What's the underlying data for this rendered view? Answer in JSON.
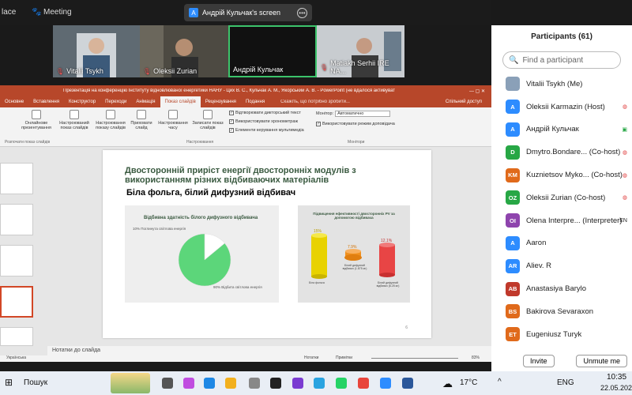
{
  "topbar": {
    "left_label": "lace",
    "meeting_label": "Meeting",
    "screen_badge": "Андрій Кульчак's screen",
    "badge_letter": "A"
  },
  "video_tiles": [
    {
      "name": "Vitalii Tsykh"
    },
    {
      "name": "Oleksii Zurian"
    },
    {
      "name": "Андрій Кульчак"
    },
    {
      "name": "Matiakh Serhii IRE NA..."
    }
  ],
  "ppt": {
    "title": "Презентація на конференцію Інституту відновлюваної енергетики НАНУ - Цих В. С., Кульчак А. М., Якорський А. В. - PowerPoint (не вдалося активувати п...",
    "tabs": [
      "Основне",
      "Вставлення",
      "Конструктор",
      "Переходи",
      "Анімація",
      "Показ слайдів",
      "Рецензування",
      "Подання"
    ],
    "active_tab": "Показ слайдів",
    "search": "Скажіть, що потрібно зробити...",
    "share": "Спільний доступ",
    "ribbon": {
      "b1": "Онлайнове презентування",
      "b2": "Настроюваний показ слайдів",
      "b3": "Настроювання показу слайдів",
      "b4": "Приховати слайд",
      "b5": "Настроювання часу",
      "b6": "Записати показ слайдів",
      "c1": "Відтворювати дикторський текст",
      "c2": "Використовувати хронометраж",
      "c3": "Елементи керування мультимедіа",
      "monitor_label": "Монітор:",
      "monitor_value": "Автоматично",
      "presenter_view": "Використовувати режим доповідача",
      "grp1": "Розпочати показ слайдів",
      "grp2": "Настроювання",
      "grp3": "Монітори"
    },
    "slide": {
      "title": "Двосторонній приріст енергії двосторонніх модулів з використанням різних відбиваючих матеріалів",
      "subtitle": "Біла фольга, білий дифузний відбивач",
      "panel1_title": "Відбивна здатність білого дифузного відбивача",
      "panel1_label_absorbed": "10% Поглинута світлова енергія",
      "panel1_label_reflected": "90% Відбита світлова енергія",
      "panel2_title": "Підвищення ефективності двосторонніх PV за допомогою відбивача",
      "cyl_labels": [
        "Біла фольга",
        "Білий дифузний відбивач (1.875 м²)",
        "Білий дифузний відбивач (6.25 м²)"
      ],
      "cyl_values": [
        "15%",
        "7.9%",
        "12.1%"
      ],
      "page_number": "6"
    },
    "notes": "Нотатки до слайда",
    "status": {
      "lang": "Українська",
      "notes": "Нотатки",
      "comments": "Примітки",
      "zoom": "83%"
    }
  },
  "chart_data": {
    "type": "pie",
    "title": "Відбивна здатність білого дифузного відбивача",
    "categories": [
      "Поглинута світлова енергія",
      "Відбита світлова енергія"
    ],
    "values": [
      14,
      86
    ],
    "labels": [
      "10% Поглинута світлова енергія",
      "90% Відбита світлова енергія"
    ],
    "colors": [
      "#ffffff",
      "#5cd67a"
    ]
  },
  "participants": {
    "header": "Participants (61)",
    "search_placeholder": "Find a participant",
    "list": [
      {
        "initials": "",
        "name": "Vitalii Tsykh (Me)",
        "color": "#8aa0b8",
        "photo": true
      },
      {
        "initials": "A",
        "name": "Oleksii Karmazin (Host)",
        "color": "#2d8cff",
        "ind": "cam-off"
      },
      {
        "initials": "A",
        "name": "Андрій Кульчак",
        "color": "#2d8cff",
        "ind": "cam-on"
      },
      {
        "initials": "D",
        "name": "Dmytro.Bondare... (Co-host)",
        "color": "#27a745",
        "ind": "cam-off"
      },
      {
        "initials": "KM",
        "name": "Kuznietsov Myko... (Co-host)",
        "color": "#e06a1b",
        "ind": "cam-off"
      },
      {
        "initials": "OZ",
        "name": "Oleksii Zurian (Co-host)",
        "color": "#27a745",
        "ind": "cam-off"
      },
      {
        "initials": "OI",
        "name": "Olena Interpre... (Interpreter)",
        "color": "#8e44ad",
        "ind": "EN"
      },
      {
        "initials": "A",
        "name": "Aaron",
        "color": "#2d8cff"
      },
      {
        "initials": "AR",
        "name": "Aliev. R",
        "color": "#2d8cff"
      },
      {
        "initials": "AB",
        "name": "Anastasiya Barylo",
        "color": "#c0392b"
      },
      {
        "initials": "BS",
        "name": "Bakirova Sevaraxon",
        "color": "#e06a1b"
      },
      {
        "initials": "ET",
        "name": "Eugeniusz Turyk",
        "color": "#e06a1b"
      }
    ],
    "invite": "Invite",
    "unmute": "Unmute me"
  },
  "taskbar": {
    "search": "Пошук",
    "temp": "17°C",
    "lang": "ENG",
    "time": "10:35",
    "date": "22.05.202"
  }
}
